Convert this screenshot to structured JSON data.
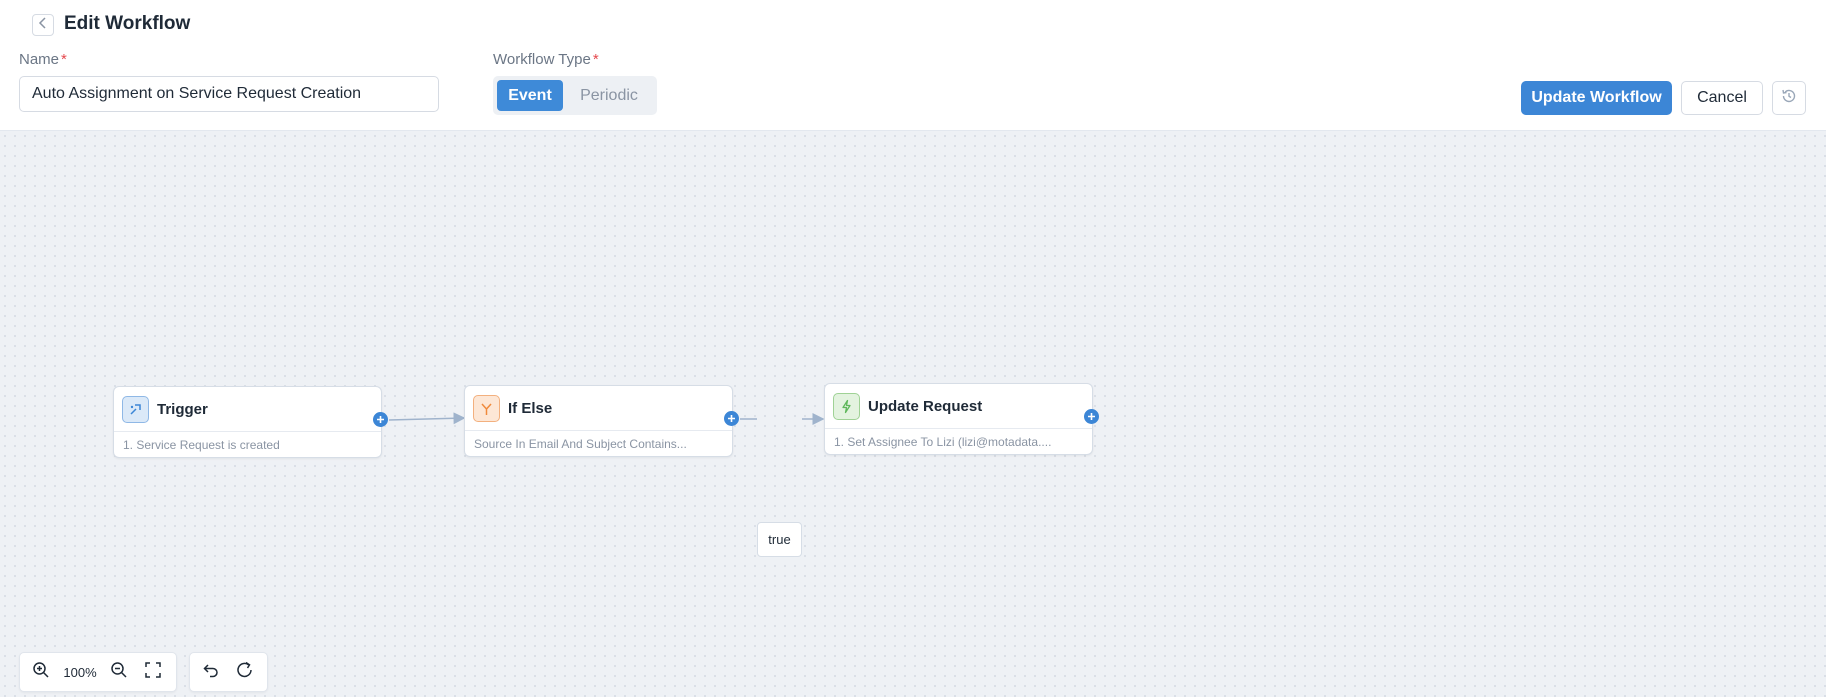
{
  "header": {
    "title": "Edit Workflow",
    "back_icon": "chevron-left-icon"
  },
  "form": {
    "name_label": "Name",
    "name_required": "*",
    "name_value": "Auto Assignment on Service Request Creation",
    "type_label": "Workflow Type",
    "type_required": "*",
    "type_options": [
      "Event",
      "Periodic"
    ],
    "type_selected": "Event"
  },
  "actions": {
    "update_label": "Update Workflow",
    "cancel_label": "Cancel",
    "history_icon": "history-icon"
  },
  "nodes": [
    {
      "title": "Trigger",
      "desc": "1. Service Request is created",
      "icon": "trigger-icon",
      "icon_color": "#3c86d6"
    },
    {
      "title": "If Else",
      "desc": "Source In Email And Subject Contains...",
      "icon": "branch-icon",
      "icon_color": "#f08a3c"
    },
    {
      "title": "Update Request",
      "desc": "1. Set Assignee To Lizi (lizi@motadata....",
      "icon": "lightning-icon",
      "icon_color": "#5fb85b"
    }
  ],
  "edge_label": "true",
  "toolbar": {
    "zoom_level": "100%"
  },
  "colors": {
    "accent": "#3c86d6",
    "required": "#e5484d"
  }
}
